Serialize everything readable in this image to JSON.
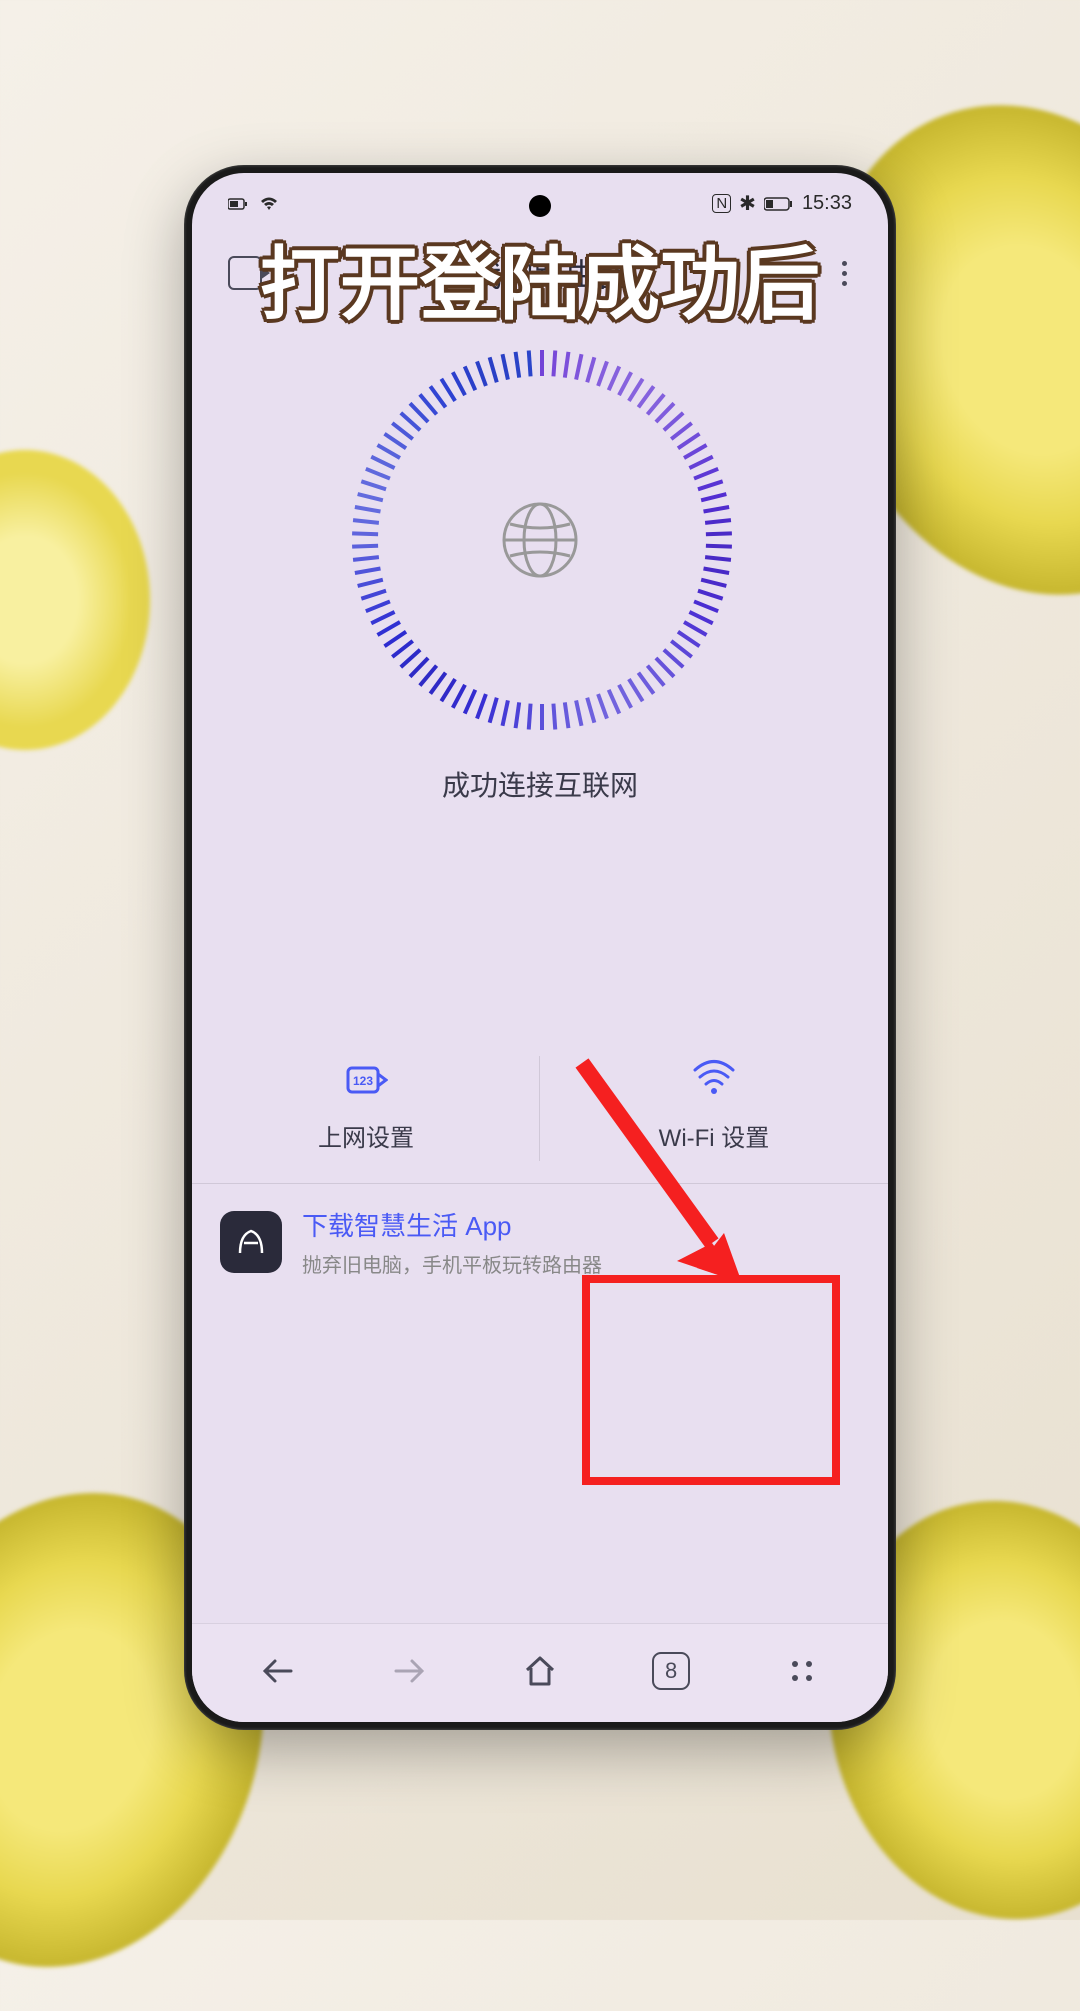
{
  "caption": "打开登陆成功后",
  "status_bar": {
    "time": "15:33",
    "nfc": "N",
    "bluetooth": "✱"
  },
  "header": {
    "title": "我的路由器"
  },
  "main": {
    "status_text": "成功连接互联网"
  },
  "actions": {
    "internet": {
      "label": "上网设置",
      "icon_text": "123"
    },
    "wifi": {
      "label": "Wi-Fi 设置"
    }
  },
  "banner": {
    "title": "下载智慧生活 App",
    "subtitle": "抛弃旧电脑，手机平板玩转路由器"
  },
  "browser": {
    "tab_count": "8"
  }
}
